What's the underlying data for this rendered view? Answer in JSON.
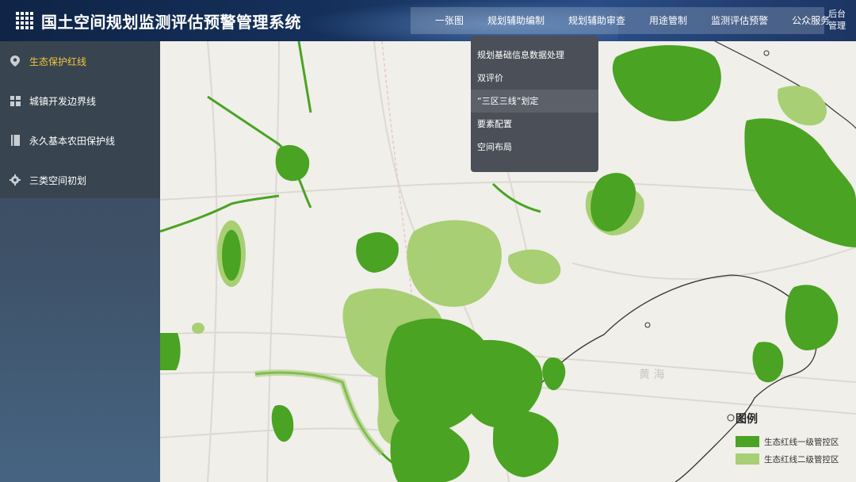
{
  "header": {
    "title": "国土空间规划监测评估预警管理系统",
    "nav": [
      "一张图",
      "规划辅助编制",
      "规划辅助审查",
      "用途管制",
      "监测评估预警",
      "公众服务"
    ],
    "backend_label": "后台管理"
  },
  "sidebar": {
    "items": [
      {
        "label": "生态保护红线",
        "icon": "location-pin-icon",
        "active": true
      },
      {
        "label": "城镇开发边界线",
        "icon": "grid-blocks-icon",
        "active": false
      },
      {
        "label": "永久基本农田保护线",
        "icon": "document-icon",
        "active": false
      },
      {
        "label": "三类空间初划",
        "icon": "gear-icon",
        "active": false
      }
    ]
  },
  "dropdown": {
    "items": [
      "规划基础信息数据处理",
      "双评价",
      "“三区三线”划定",
      "要素配置",
      "空间布局"
    ],
    "highlighted": "“三区三线”划定"
  },
  "map": {
    "sea_label": "黄 海"
  },
  "legend": {
    "title": "图例",
    "items": [
      {
        "label": "生态红线一级管控区",
        "color": "#4aa322"
      },
      {
        "label": "生态红线二级管控区",
        "color": "#a8cf73"
      }
    ]
  },
  "colors": {
    "accent_active": "#f3c540",
    "level1_green": "#4aa322",
    "level2_green": "#a8cf73"
  }
}
